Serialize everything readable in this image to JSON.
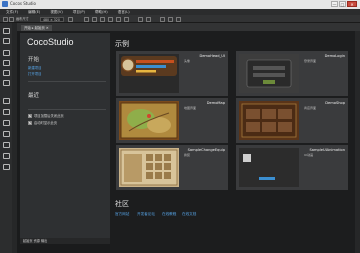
{
  "window": {
    "title": "Cocos Studio",
    "controls": [
      "—",
      "□",
      "✕"
    ]
  },
  "menu": [
    "文件(F)",
    "编辑(E)",
    "视图(V)",
    "项目(P)",
    "帮助(H)",
    "语言(L)"
  ],
  "toolbar": {
    "resolution_label": "画布尺寸",
    "resolution": "480 × 320"
  },
  "doc_tab": {
    "label": "开始 ▸ 起始页 ✕"
  },
  "start": {
    "logo": "CocoStudio",
    "open_heading": "开始",
    "new_project": "新建项目",
    "open_project": "打开项目",
    "recent_heading": "最近",
    "check1": "项目加载后关闭此页",
    "check2": "启动时显示此页",
    "bottom_tabs": "起始页 资源 输出"
  },
  "examples": {
    "heading": "示例",
    "cards": [
      {
        "name": "DemoHead_UI",
        "desc": "头像"
      },
      {
        "name": "DemoLogin",
        "desc": "登录界面"
      },
      {
        "name": "DemoMap",
        "desc": "地图界面"
      },
      {
        "name": "DemoShop",
        "desc": "商店界面"
      },
      {
        "name": "SampleChangeEquip",
        "desc": "换装"
      },
      {
        "name": "SampleUIAnimation",
        "desc": "UI动画"
      }
    ]
  },
  "community": {
    "heading": "社区",
    "links": [
      "官方网站",
      "开发者论坛",
      "在线教程",
      "在线文档"
    ]
  }
}
